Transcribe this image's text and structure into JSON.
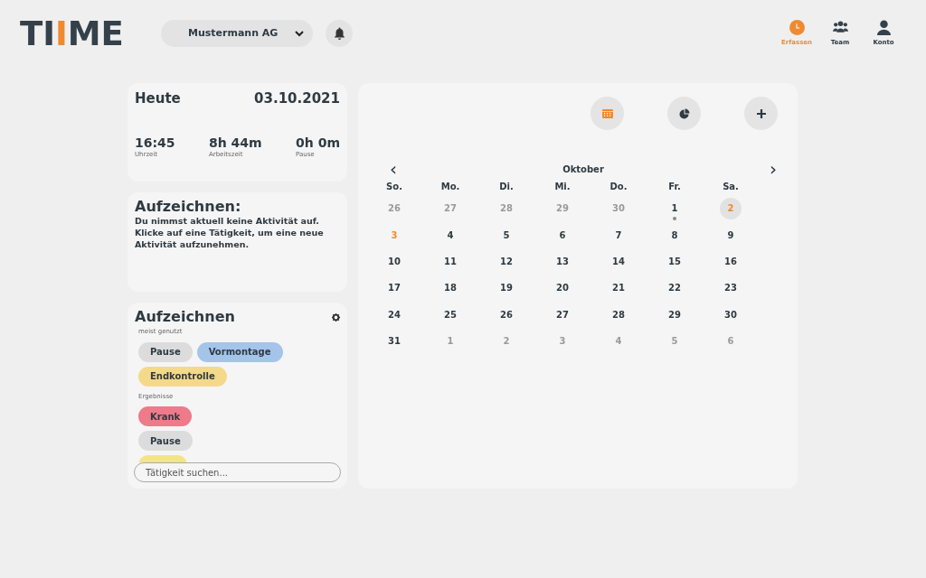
{
  "logo": {
    "parts": [
      {
        "text": "TI",
        "accent": false
      },
      {
        "text": "I",
        "accent": true
      },
      {
        "text": "ME",
        "accent": false
      }
    ]
  },
  "company_select": {
    "value": "Mustermann AG"
  },
  "nav": [
    {
      "label": "Erfassen",
      "selected": true
    },
    {
      "label": "Team",
      "selected": false
    },
    {
      "label": "Konto",
      "selected": false
    }
  ],
  "today_card": {
    "title": "Heute",
    "date": "03.10.2021",
    "stats": [
      {
        "value": "16:45",
        "label": "Uhrzeit"
      },
      {
        "value": "8h 44m",
        "label": "Arbeitszeit"
      },
      {
        "value": "0h 0m",
        "label": "Pause"
      }
    ]
  },
  "recording_card": {
    "title": "Aufzeichnen:",
    "message": "Du nimmst aktuell keine Aktivität auf. Klicke auf eine Tätigkeit, um eine neue Aktivität aufzunehmen."
  },
  "activities_card": {
    "title": "Aufzeichnen",
    "sections": [
      {
        "heading": "meist genutzt",
        "chips": [
          {
            "label": "Pause",
            "color": "#dcdcdc"
          },
          {
            "label": "Vormontage",
            "color": "#a4c4ea"
          },
          {
            "label": "Endkontrolle",
            "color": "#f5d98a"
          }
        ]
      },
      {
        "heading": "Ergebnisse",
        "chips": [
          {
            "label": "Krank",
            "color": "#ee7a8a"
          },
          {
            "label": "Pause",
            "color": "#dcdcdc"
          },
          {
            "color": "#f2e48a"
          }
        ]
      }
    ],
    "search": {
      "placeholder": "Tätigkeit suchen..."
    }
  },
  "calendar": {
    "actions": [
      {
        "active": true
      },
      {
        "active": false
      },
      {
        "active": false
      }
    ],
    "month": "Oktober",
    "prev": "‹",
    "next": "›",
    "weekdays": [
      "So.",
      "Mo.",
      "Di.",
      "Mi.",
      "Do.",
      "Fr.",
      "Sa."
    ],
    "weeks": [
      [
        {
          "day": "26",
          "muted": true
        },
        {
          "day": "27",
          "muted": true
        },
        {
          "day": "28",
          "muted": true
        },
        {
          "day": "29",
          "muted": true
        },
        {
          "day": "30",
          "muted": true
        },
        {
          "day": "1",
          "muted": false,
          "has_entry": true
        },
        {
          "day": "2",
          "muted": false,
          "selected": true
        }
      ],
      [
        {
          "day": "3",
          "muted": false,
          "today": true
        },
        {
          "day": "4",
          "muted": false
        },
        {
          "day": "5",
          "muted": false
        },
        {
          "day": "6",
          "muted": false
        },
        {
          "day": "7",
          "muted": false
        },
        {
          "day": "8",
          "muted": false
        },
        {
          "day": "9",
          "muted": false
        }
      ],
      [
        {
          "day": "10",
          "muted": false
        },
        {
          "day": "11",
          "muted": false
        },
        {
          "day": "12",
          "muted": false
        },
        {
          "day": "13",
          "muted": false
        },
        {
          "day": "14",
          "muted": false
        },
        {
          "day": "15",
          "muted": false
        },
        {
          "day": "16",
          "muted": false
        }
      ],
      [
        {
          "day": "17",
          "muted": false
        },
        {
          "day": "18",
          "muted": false
        },
        {
          "day": "19",
          "muted": false
        },
        {
          "day": "20",
          "muted": false
        },
        {
          "day": "21",
          "muted": false
        },
        {
          "day": "22",
          "muted": false
        },
        {
          "day": "23",
          "muted": false
        }
      ],
      [
        {
          "day": "24",
          "muted": false
        },
        {
          "day": "25",
          "muted": false
        },
        {
          "day": "26",
          "muted": false
        },
        {
          "day": "27",
          "muted": false
        },
        {
          "day": "28",
          "muted": false
        },
        {
          "day": "29",
          "muted": false
        },
        {
          "day": "30",
          "muted": false
        }
      ],
      [
        {
          "day": "31",
          "muted": false
        },
        {
          "day": "1",
          "muted": true
        },
        {
          "day": "2",
          "muted": true
        },
        {
          "day": "3",
          "muted": true
        },
        {
          "day": "4",
          "muted": true
        },
        {
          "day": "5",
          "muted": true
        },
        {
          "day": "6",
          "muted": true
        }
      ]
    ]
  }
}
